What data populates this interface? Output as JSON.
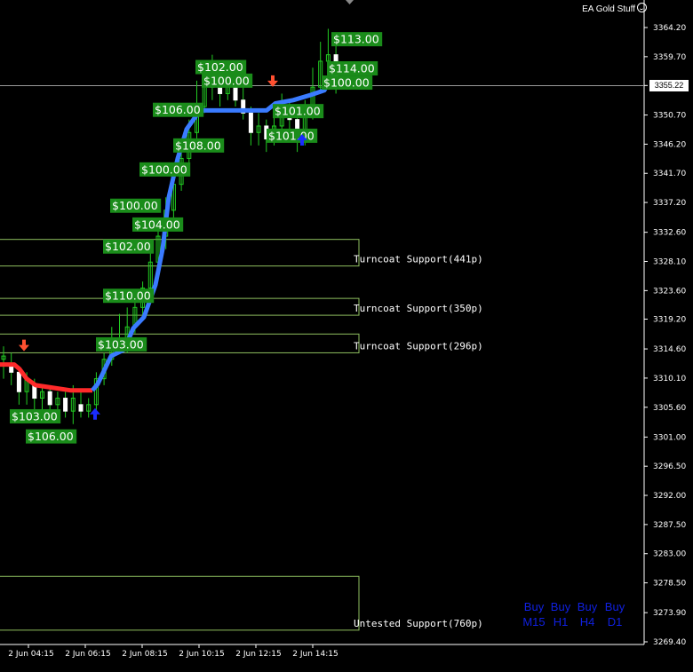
{
  "window": {
    "title": "EA Gold Stuff"
  },
  "colors": {
    "background": "#000000",
    "grid_axis": "#ffffff",
    "zone": "#8fbf5f",
    "bull_candle": "#22cc22",
    "bear_candle": "#ffffff",
    "trend_up": "#3a7bff",
    "trend_down": "#ff2a2a",
    "label_bg": "#1a8c1a",
    "label_text": "#ffffff",
    "arrow_up": "#1a2cff",
    "arrow_down": "#ff5030",
    "signal_text": "#1020e0"
  },
  "current_price": "3355.22",
  "chart_data": {
    "type": "candlestick",
    "y_ticks": [
      "3364.20",
      "3359.70",
      "3355.25",
      "3350.70",
      "3346.20",
      "3341.70",
      "3337.20",
      "3332.60",
      "3328.10",
      "3323.60",
      "3319.20",
      "3314.60",
      "3310.10",
      "3305.60",
      "3301.00",
      "3296.50",
      "3292.00",
      "3287.50",
      "3283.00",
      "3278.50",
      "3273.90",
      "3269.40"
    ],
    "ylim": [
      3269.4,
      3364.2
    ],
    "x_ticks": [
      "2 Jun 04:15",
      "2 Jun 06:15",
      "2 Jun 08:15",
      "2 Jun 10:15",
      "2 Jun 12:15",
      "2 Jun 14:15"
    ],
    "zones": [
      {
        "label": "Turncoat Support(441p)",
        "low": 3327.4,
        "high": 3331.5
      },
      {
        "label": "Turncoat Support(350p)",
        "low": 3319.8,
        "high": 3322.4
      },
      {
        "label": "Turncoat Support(296p)",
        "low": 3314.0,
        "high": 3316.9
      },
      {
        "label": "Untested Support(760p)",
        "low": 3271.2,
        "high": 3279.5
      }
    ],
    "price_line": 3355.22,
    "trend_up_label": "trend-line-blue",
    "profit_labels": [
      "$113.00",
      "$114.00",
      "$100.00",
      "$102.00",
      "$100.00",
      "$106.00",
      "$101.00",
      "$101.00",
      "$108.00",
      "$100.00",
      "$100.00",
      "$104.00",
      "$102.00",
      "$110.00",
      "$103.00",
      "$103.00",
      "$106.00"
    ],
    "signal_arrows": [
      {
        "dir": "down",
        "price": 3356.0
      },
      {
        "dir": "down",
        "price": 3315.2
      },
      {
        "dir": "up",
        "price": 3304.5
      },
      {
        "dir": "up",
        "price": 3346.8
      }
    ]
  },
  "signals": [
    {
      "label": "Buy",
      "tf": "M15"
    },
    {
      "label": "Buy",
      "tf": "H1"
    },
    {
      "label": "Buy",
      "tf": "H4"
    },
    {
      "label": "Buy",
      "tf": "D1"
    }
  ]
}
